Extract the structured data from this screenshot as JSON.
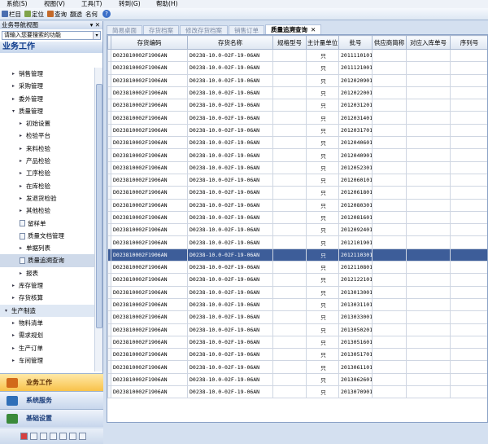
{
  "menu": [
    "系统(S)",
    "视图(V)",
    "工具(T)",
    "转到(G)",
    "帮助(H)"
  ],
  "toolbar": {
    "items": [
      "栏目",
      "定位",
      "查询",
      "翻透",
      "名何"
    ],
    "help": "?"
  },
  "left_panel": {
    "title": "业务导航视图",
    "pin": "▾ ✕",
    "search_placeholder": "请输入您要搜索的功能",
    "heading": "业务工作",
    "tree": [
      {
        "label": "销售管理",
        "level": 1,
        "arrow": "▸"
      },
      {
        "label": "采购管理",
        "level": 1,
        "arrow": "▸"
      },
      {
        "label": "委外管理",
        "level": 1,
        "arrow": "▸"
      },
      {
        "label": "质量管理",
        "level": 1,
        "arrow": "▾"
      },
      {
        "label": "初始设置",
        "level": 2,
        "arrow": "▸"
      },
      {
        "label": "检验平台",
        "level": 2,
        "arrow": "▸"
      },
      {
        "label": "来料检验",
        "level": 2,
        "arrow": "▸"
      },
      {
        "label": "产品检验",
        "level": 2,
        "arrow": "▸"
      },
      {
        "label": "工序检验",
        "level": 2,
        "arrow": "▸"
      },
      {
        "label": "在库检验",
        "level": 2,
        "arrow": "▸"
      },
      {
        "label": "发退货检验",
        "level": 2,
        "arrow": "▸"
      },
      {
        "label": "其他检验",
        "level": 2,
        "arrow": "▸"
      },
      {
        "label": "留样单",
        "level": 2,
        "arrow": "doc"
      },
      {
        "label": "质量文档管理",
        "level": 2,
        "arrow": "doc"
      },
      {
        "label": "单据列表",
        "level": 2,
        "arrow": "▸"
      },
      {
        "label": "质量追溯查询",
        "level": 2,
        "arrow": "doc",
        "selected": true
      },
      {
        "label": "报表",
        "level": 2,
        "arrow": "▸"
      },
      {
        "label": "库存管理",
        "level": 1,
        "arrow": "▸"
      },
      {
        "label": "存货核算",
        "level": 1,
        "arrow": "▸"
      },
      {
        "label": "生产制造",
        "level": 0,
        "arrow": "▾",
        "group": true
      },
      {
        "label": "物料清单",
        "level": 1,
        "arrow": "▸"
      },
      {
        "label": "需求规划",
        "level": 1,
        "arrow": "▸"
      },
      {
        "label": "生产订单",
        "level": 1,
        "arrow": "▸"
      },
      {
        "label": "车间管理",
        "level": 1,
        "arrow": "▸"
      }
    ],
    "nav_buttons": [
      {
        "label": "业务工作",
        "active": true,
        "color": "#d26a1a"
      },
      {
        "label": "系统服务",
        "active": false,
        "color": "#2f6fb8"
      },
      {
        "label": "基础设置",
        "active": false,
        "color": "#3a8a3a"
      }
    ]
  },
  "tabs": [
    {
      "label": "简易桌面",
      "active": false
    },
    {
      "label": "存货档案",
      "active": false
    },
    {
      "label": "修改存货档案",
      "active": false
    },
    {
      "label": "销售订单",
      "active": false
    },
    {
      "label": "质量追溯查询",
      "active": true,
      "close": "✕"
    }
  ],
  "grid": {
    "columns": [
      "存货编码",
      "存货名称",
      "规格型号",
      "主计量单位",
      "批号",
      "供应商简称",
      "对应入库单号",
      "序列号"
    ],
    "code": "D023810002F1906AN",
    "name": "D0238-10.0-02F-19-06AN",
    "unit": "只",
    "selected_index": 16,
    "batches": [
      "2011110101",
      "2011121001",
      "2012020901",
      "2012022001",
      "2012031201",
      "2012031401",
      "2012031701",
      "2012040601",
      "2012040901",
      "2012052301",
      "2012060101",
      "2012061801",
      "2012080301",
      "2012081601",
      "2012092401",
      "2012101901",
      "2012110301",
      "2012110801",
      "2012122101",
      "2013013001",
      "2013031101",
      "2013033001",
      "2013050201",
      "2013051601",
      "2013051701",
      "2013061101",
      "2013062601",
      "2013070901"
    ]
  },
  "colors": {
    "selected_row": "#3d5d99",
    "active_nav": "#f8c24a"
  }
}
